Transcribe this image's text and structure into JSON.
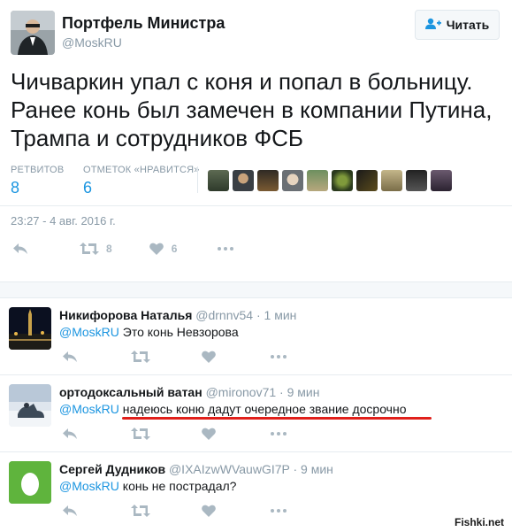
{
  "main_tweet": {
    "display_name": "Портфель Министра",
    "handle": "@MoskRU",
    "follow_label": "Читать",
    "text": "Чичваркин упал с коня и попал в больницу. Ранее конь был замечен в компании Путина, Трампа и сотрудников ФСБ",
    "retweets_label": "РЕТВИТОВ",
    "retweets_count": "8",
    "likes_label": "ОТМЕТОК «НРАВИТСЯ»",
    "likes_count": "6",
    "timestamp": "23:27 - 4 авг. 2016 г.",
    "action_retweet_count": "8",
    "action_like_count": "6"
  },
  "replies": [
    {
      "display_name": "Никифорова Наталья",
      "handle": "@drnnv54",
      "time": "1 мин",
      "mention": "@MoskRU",
      "text": "Это конь Невзорова"
    },
    {
      "display_name": "ортодоксальный ватан",
      "handle": "@mironov71",
      "time": "9 мин",
      "mention": "@MoskRU",
      "text": "надеюсь коню дадут очередное звание досрочно"
    },
    {
      "display_name": "Сергей Дудников",
      "handle": "@IXAIzwWVauwGI7P",
      "time": "9 мин",
      "mention": "@MoskRU",
      "text": "конь не пострадал?"
    }
  ],
  "separator": "·",
  "watermark": "Fishki.net",
  "colors": {
    "link_blue": "#1b95e0",
    "muted_gray": "#8899a6",
    "icon_gray": "#aab8c2",
    "underline_red": "#e0201b",
    "egg_green": "#5fb43d"
  },
  "icons": [
    "person-plus-icon",
    "reply-icon",
    "retweet-icon",
    "heart-icon",
    "more-icon",
    "egg-avatar-icon"
  ]
}
